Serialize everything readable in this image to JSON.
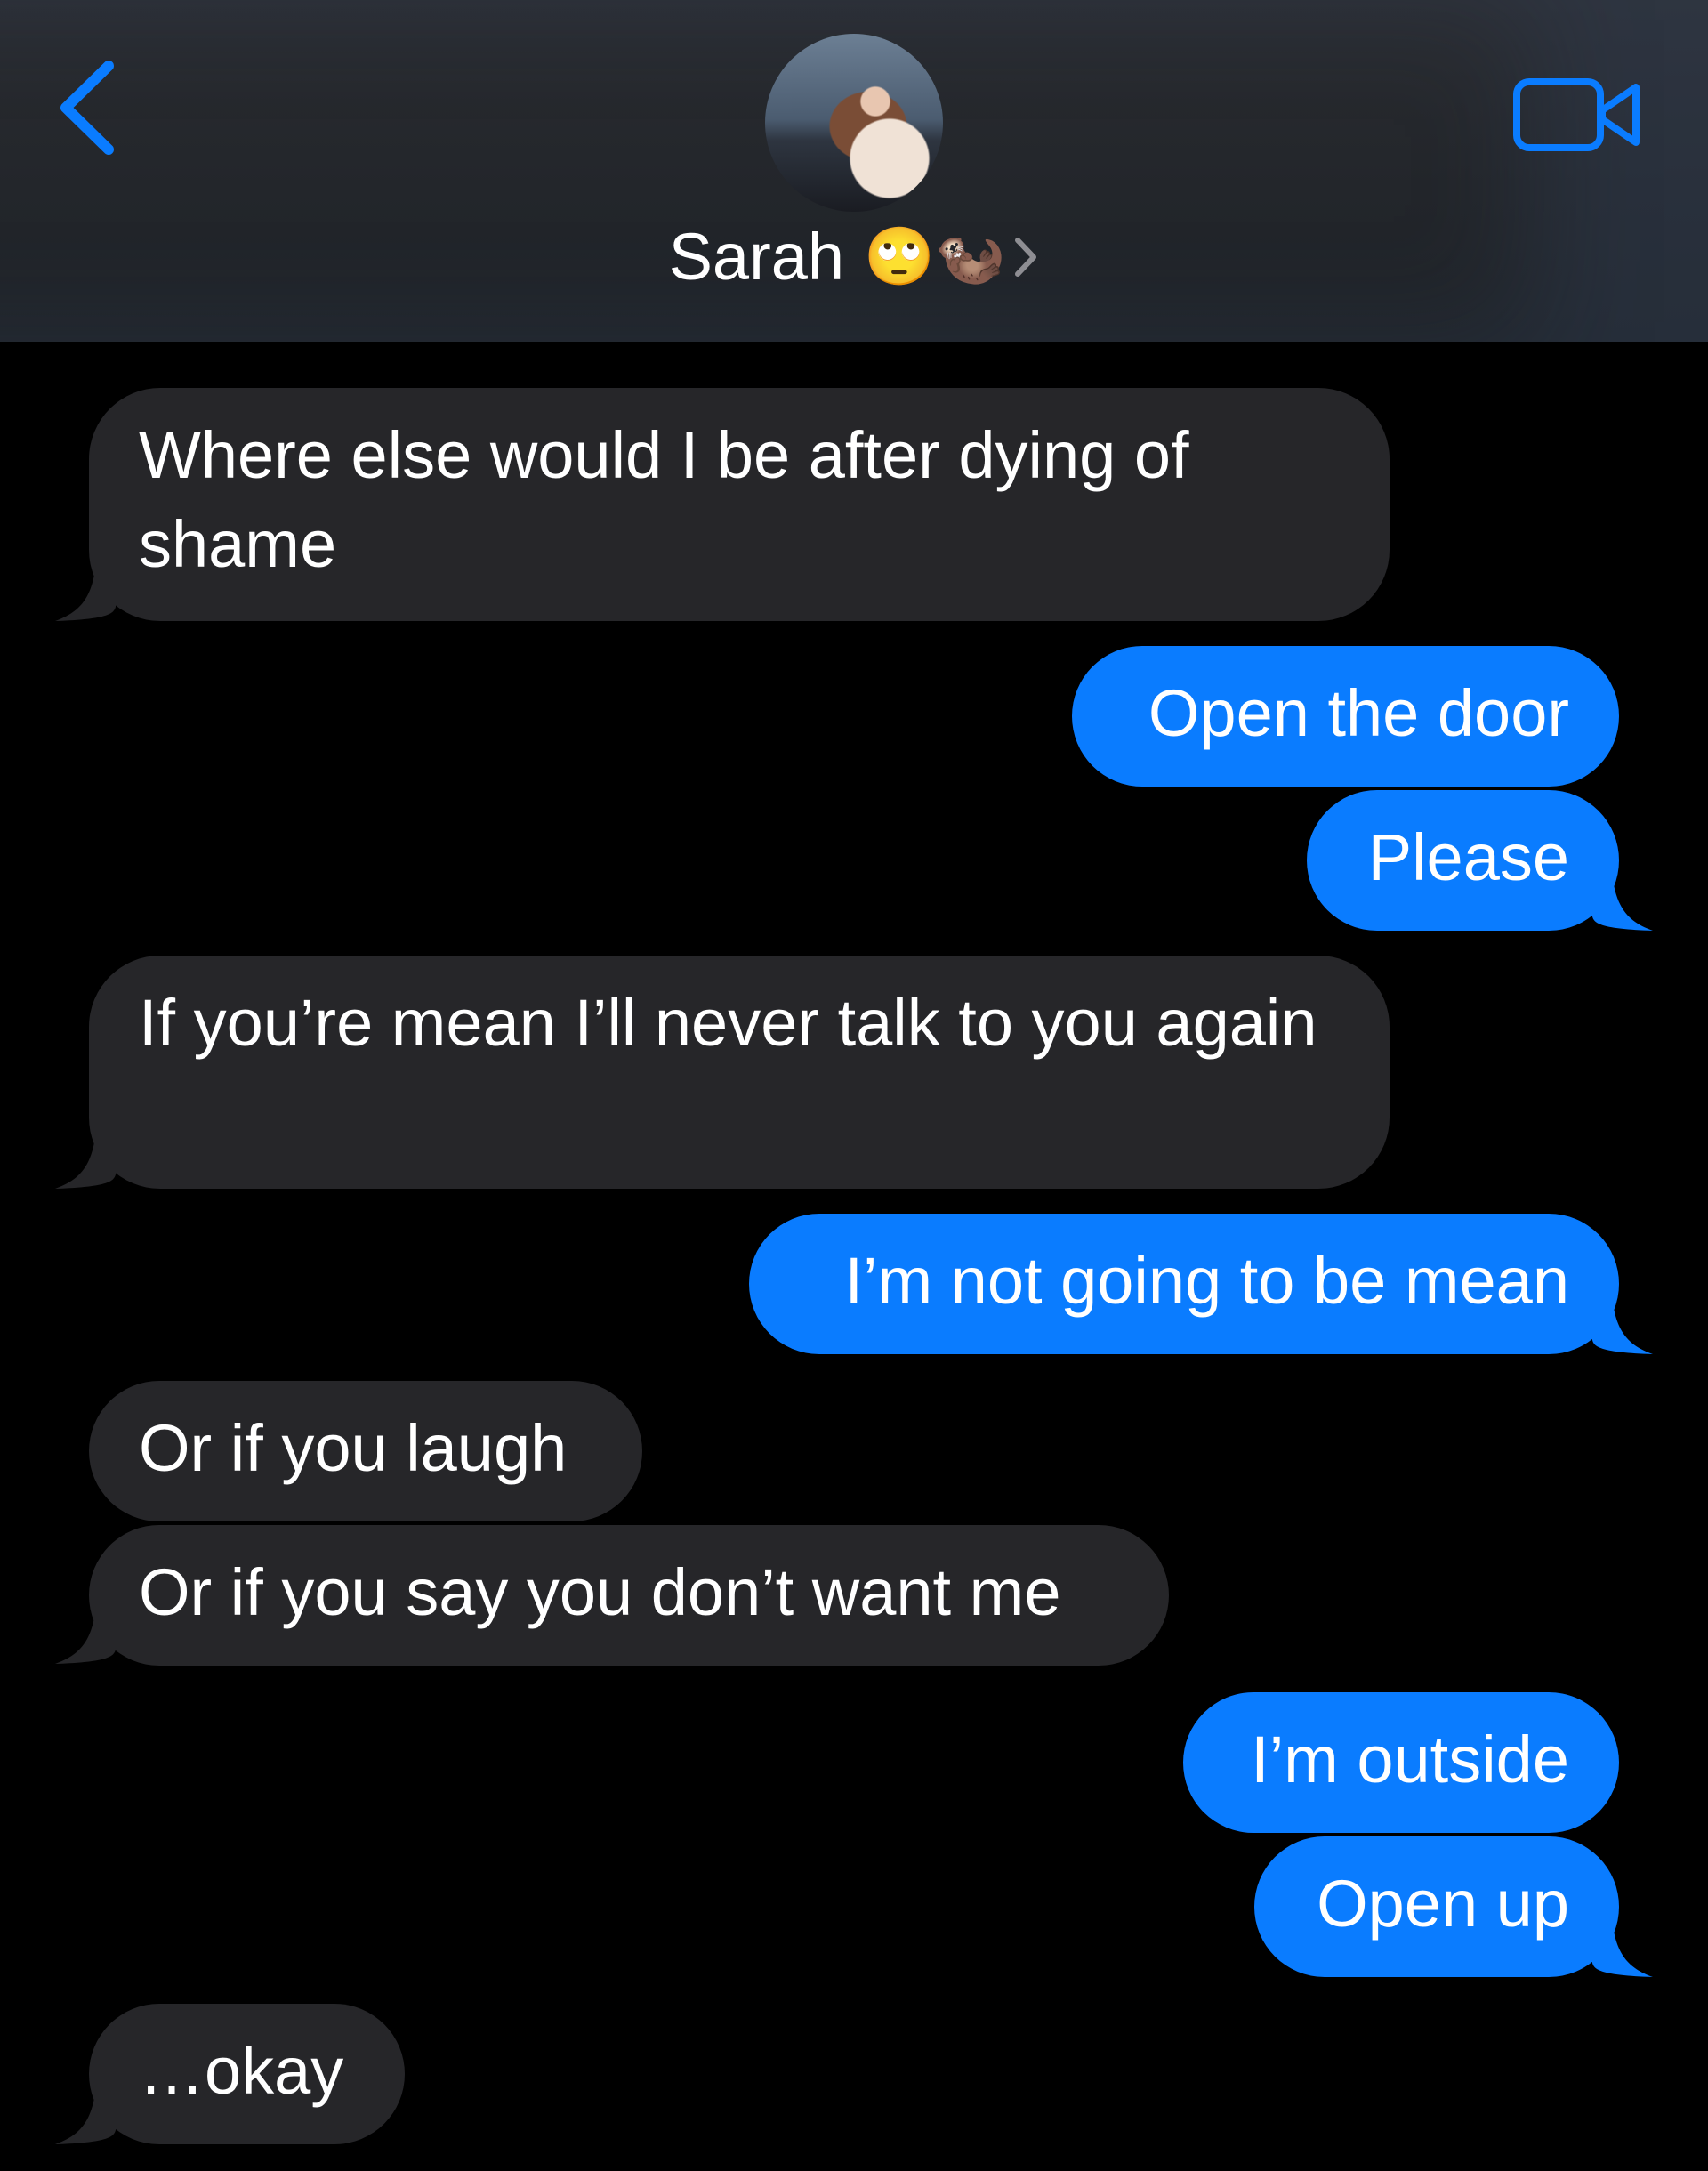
{
  "header": {
    "contact_name": "Sarah",
    "contact_emojis": "🙄🦦",
    "back_icon": "chevron-left-icon",
    "video_icon": "video-camera-icon",
    "accent_color": "#0a7cff"
  },
  "messages": [
    {
      "direction": "received",
      "text": "Where else would I be after dying of shame"
    },
    {
      "direction": "sent",
      "text": "Open the door"
    },
    {
      "direction": "sent",
      "text": "Please"
    },
    {
      "direction": "received",
      "text": "If you’re mean I’ll never talk to you again"
    },
    {
      "direction": "sent",
      "text": "I’m not going to be mean"
    },
    {
      "direction": "received",
      "text": "Or if you laugh"
    },
    {
      "direction": "received",
      "text": "Or if you say you don’t want me"
    },
    {
      "direction": "sent",
      "text": "I’m outside"
    },
    {
      "direction": "sent",
      "text": "Open up"
    },
    {
      "direction": "received",
      "text": "…okay"
    }
  ]
}
